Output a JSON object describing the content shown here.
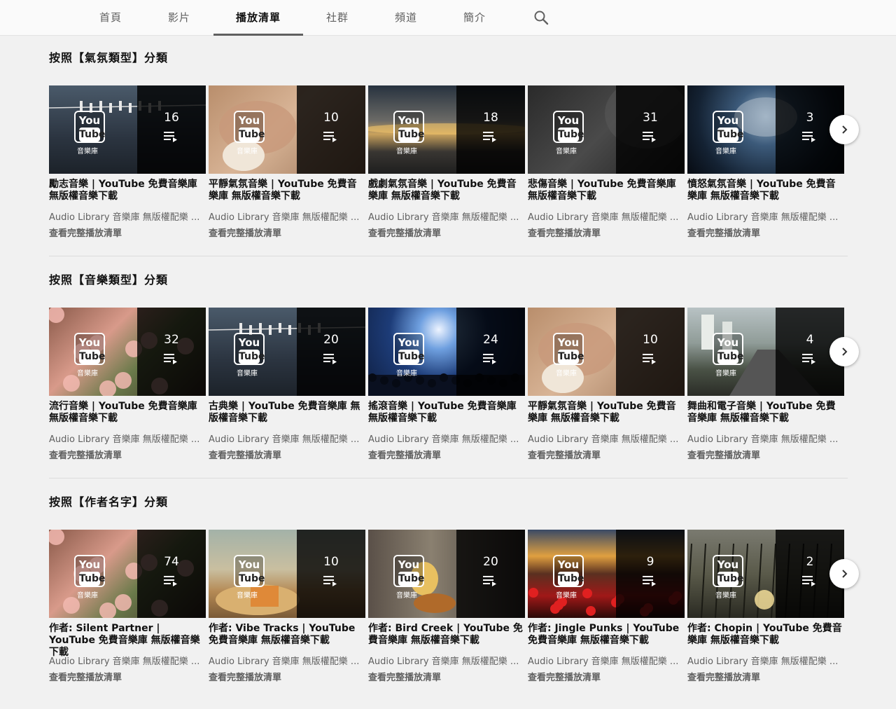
{
  "tabs": [
    {
      "label": "首頁",
      "active": false
    },
    {
      "label": "影片",
      "active": false
    },
    {
      "label": "播放清單",
      "active": true
    },
    {
      "label": "社群",
      "active": false
    },
    {
      "label": "頻道",
      "active": false
    },
    {
      "label": "簡介",
      "active": false
    }
  ],
  "search_icon": "search-icon",
  "thumbnail_logo": {
    "you": "You",
    "tube": "Tube",
    "caption": "音樂庫"
  },
  "playlist_icon": "playlist-icon",
  "next_icon": "chevron-right-icon",
  "sections": [
    {
      "title": "按照【氣氛類型】分類",
      "cards": [
        {
          "count": "16",
          "title": "勵志音樂 | YouTube 免費音樂庫 無版權音樂下載",
          "subtitle": "Audio Library 音樂庫 無版權配樂 ...",
          "link": "查看完整播放清單",
          "theme": "clothes"
        },
        {
          "count": "10",
          "title": "平靜氣氛音樂 | YouTube 免費音樂庫 無版權音樂下載",
          "subtitle": "Audio Library 音樂庫 無版權配樂 ...",
          "link": "查看完整播放清單",
          "theme": "sleep"
        },
        {
          "count": "18",
          "title": "戲劇氣氛音樂 | YouTube 免費音樂庫 無版權音樂下載",
          "subtitle": "Audio Library 音樂庫 無版權配樂 ...",
          "link": "查看完整播放清單",
          "theme": "sunset"
        },
        {
          "count": "31",
          "title": "悲傷音樂 | YouTube 免費音樂庫 無版權音樂下載",
          "subtitle": "Audio Library 音樂庫 無版權配樂 ...",
          "link": "查看完整播放清單",
          "theme": "dark"
        },
        {
          "count": "3",
          "title": "憤怒氣氛音樂 | YouTube 免費音樂庫 無版權音樂下載",
          "subtitle": "Audio Library 音樂庫 無版權配樂 ...",
          "link": "查看完整播放清單",
          "theme": "storm"
        }
      ]
    },
    {
      "title": "按照【音樂類型】分類",
      "cards": [
        {
          "count": "32",
          "title": "流行音樂 | YouTube 免費音樂庫 無版權音樂下載",
          "subtitle": "Audio Library 音樂庫 無版權配樂 ...",
          "link": "查看完整播放清單",
          "theme": "flowers"
        },
        {
          "count": "20",
          "title": "古典樂 | YouTube 免費音樂庫 無版權音樂下載",
          "subtitle": "Audio Library 音樂庫 無版權配樂 ...",
          "link": "查看完整播放清單",
          "theme": "clothes"
        },
        {
          "count": "24",
          "title": "搖滾音樂 | YouTube 免費音樂庫 無版權音樂下載",
          "subtitle": "Audio Library 音樂庫 無版權配樂 ...",
          "link": "查看完整播放清單",
          "theme": "concert"
        },
        {
          "count": "10",
          "title": "平靜氣氛音樂 | YouTube 免費音樂庫 無版權音樂下載",
          "subtitle": "Audio Library 音樂庫 無版權配樂 ...",
          "link": "查看完整播放清單",
          "theme": "sleep"
        },
        {
          "count": "4",
          "title": "舞曲和電子音樂 | YouTube 免費音樂庫 無版權音樂下載",
          "subtitle": "Audio Library 音樂庫 無版權配樂 ...",
          "link": "查看完整播放清單",
          "theme": "rail"
        }
      ]
    },
    {
      "title": "按照【作者名字】分類",
      "cards": [
        {
          "count": "74",
          "title": "作者: Silent Partner | YouTube 免費音樂庫 無版權音樂下載",
          "subtitle": "Audio Library 音樂庫 無版權配樂 ...",
          "link": "查看完整播放清單",
          "theme": "flowers"
        },
        {
          "count": "10",
          "title": "作者: Vibe Tracks | YouTube 免費音樂庫 無版權音樂下載",
          "subtitle": "Audio Library 音樂庫 無版權配樂 ...",
          "link": "查看完整播放清單",
          "theme": "skate"
        },
        {
          "count": "20",
          "title": "作者: Bird Creek | YouTube 免費音樂庫 無版權音樂下載",
          "subtitle": "Audio Library 音樂庫 無版權配樂 ...",
          "link": "查看完整播放清單",
          "theme": "guitar"
        },
        {
          "count": "9",
          "title": "作者: Jingle Punks | YouTube 免費音樂庫 無版權音樂下載",
          "subtitle": "Audio Library 音樂庫 無版權配樂 ...",
          "link": "查看完整播放清單",
          "theme": "poppies"
        },
        {
          "count": "2",
          "title": "作者: Chopin | YouTube 免費音樂庫 無版權音樂下載",
          "subtitle": "Audio Library 音樂庫 無版權配樂 ...",
          "link": "查看完整播放清單",
          "theme": "reeds"
        }
      ]
    }
  ]
}
